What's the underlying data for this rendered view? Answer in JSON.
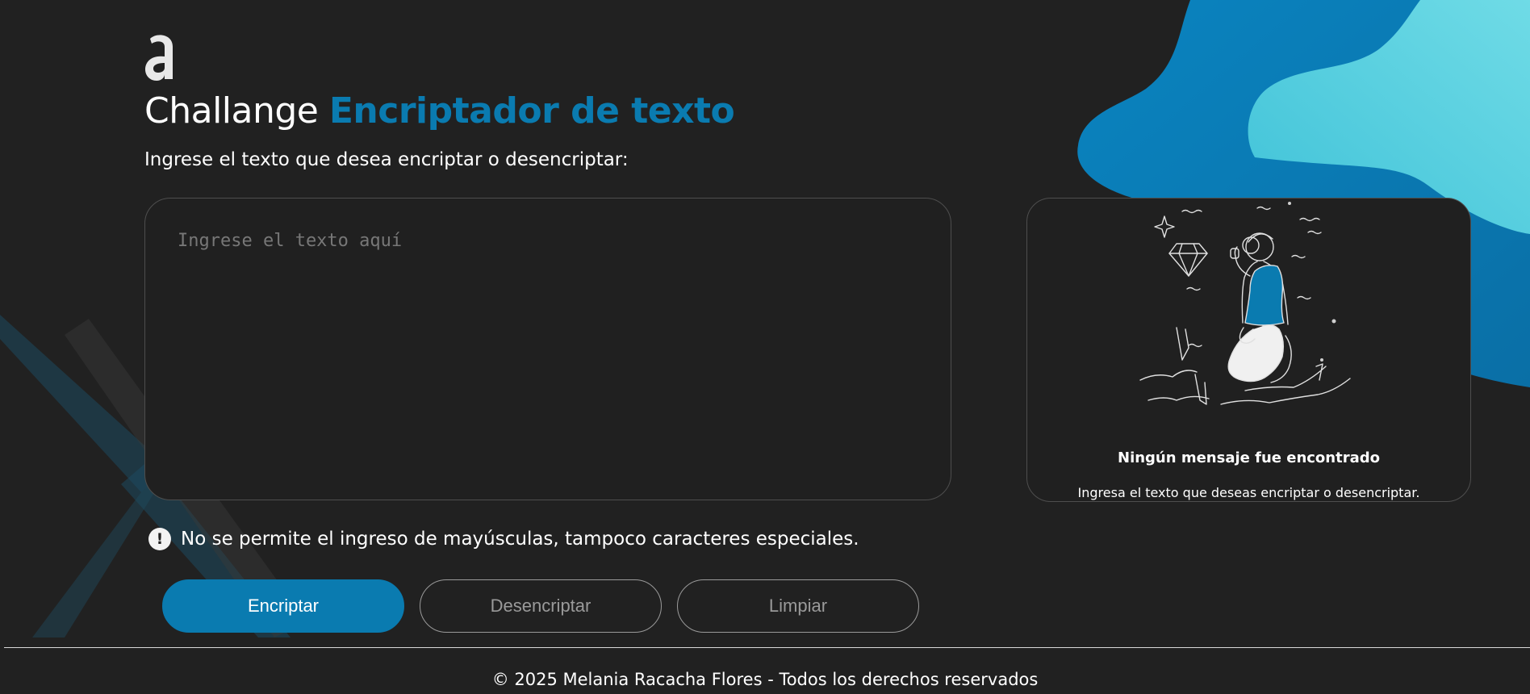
{
  "header": {
    "logo_icon": "alura-a-logo-icon",
    "title_plain": "Challange",
    "title_accent": "Encriptador de texto",
    "subtitle": "Ingrese el texto que desea encriptar o desencriptar:"
  },
  "input": {
    "value": "",
    "placeholder": "Ingrese el texto aquí"
  },
  "warning": {
    "icon": "exclamation-circle-icon",
    "text": "No se permite el ingreso de mayúsculas, tampoco caracteres especiales."
  },
  "buttons": {
    "encrypt": "Encriptar",
    "decrypt": "Desencriptar",
    "clear": "Limpiar"
  },
  "output": {
    "illustration": "explorer-with-magnifier-illustration",
    "title": "Ningún mensaje fue encontrado",
    "text": "Ingresa el texto que deseas encriptar o desencriptar."
  },
  "footer": {
    "text": "© 2025 Melania Racacha Flores - Todos los derechos reservados"
  },
  "colors": {
    "background": "#212121",
    "accent": "#0a7bb0",
    "accent_light": "#5fd3e0",
    "border": "#4e4e4e"
  }
}
